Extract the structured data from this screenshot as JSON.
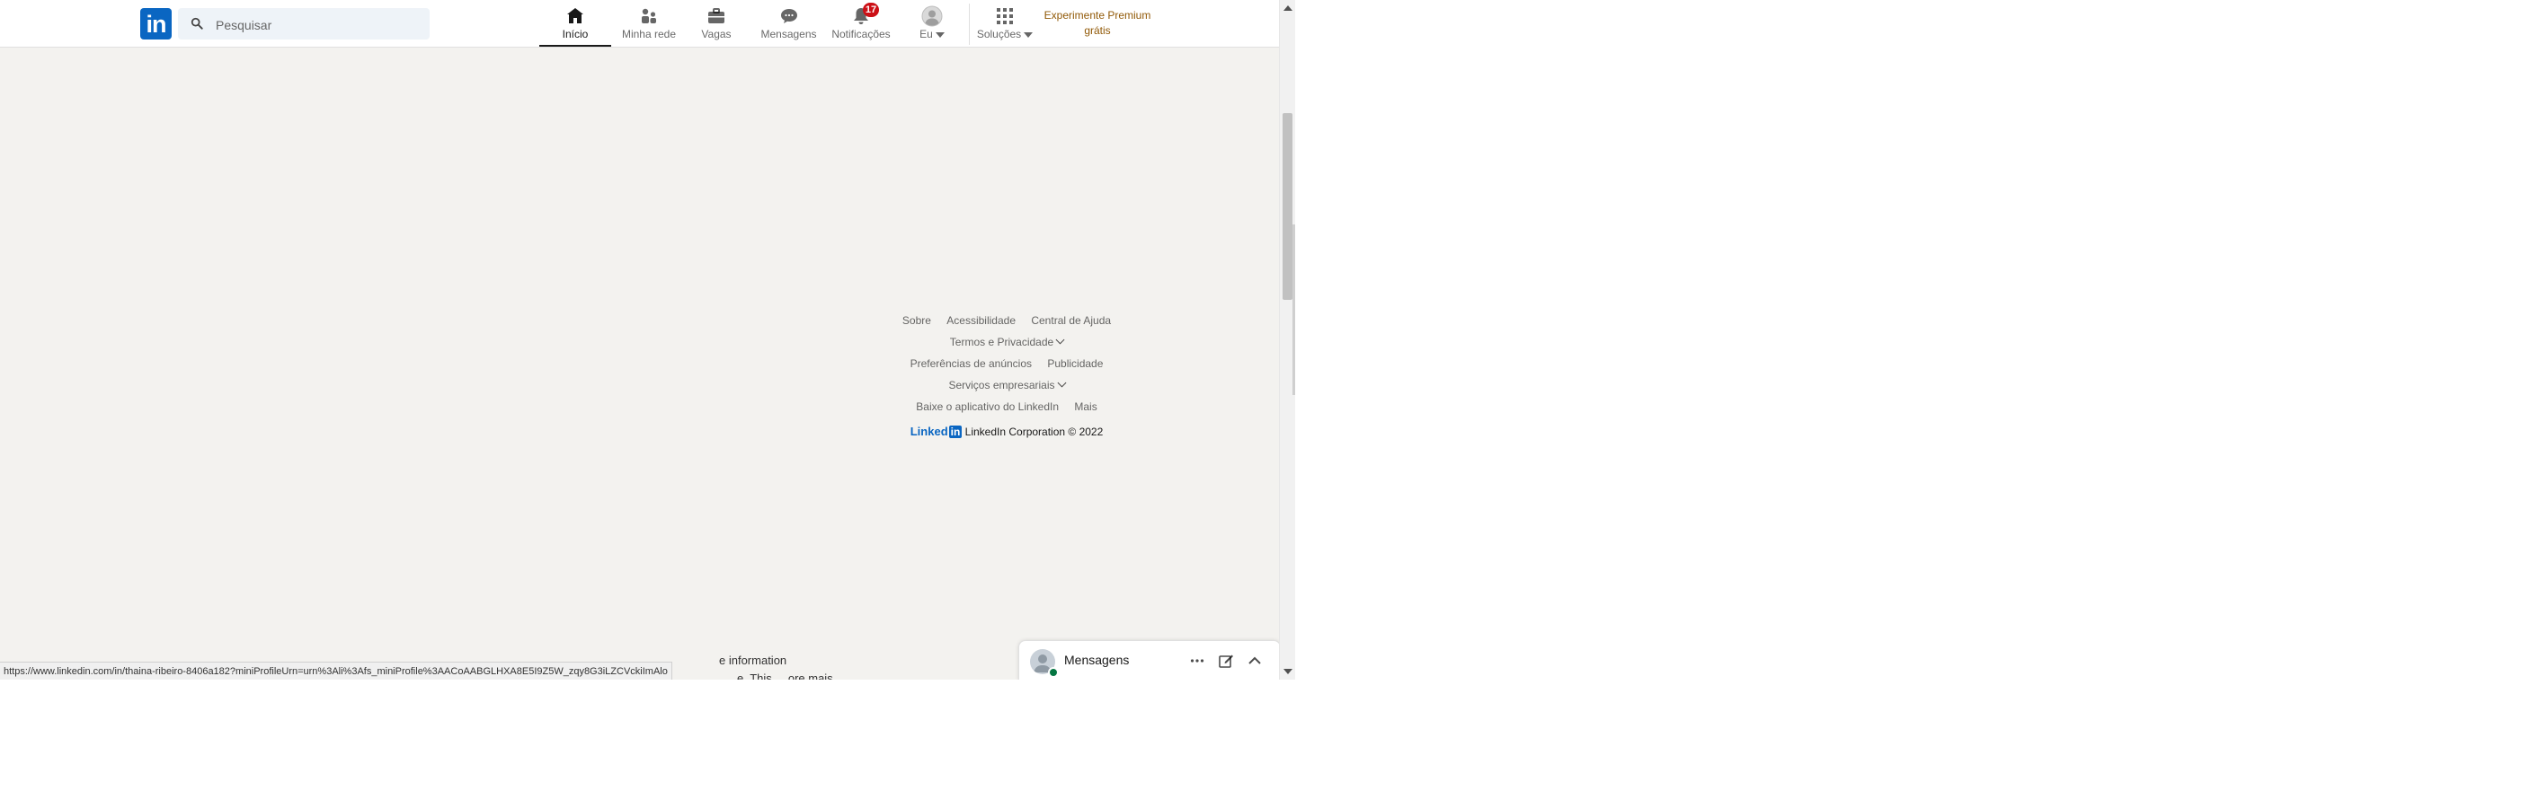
{
  "nav": {
    "search": {
      "placeholder": "Pesquisar"
    },
    "items": [
      {
        "label": "Início",
        "icon": "home-icon",
        "active": true
      },
      {
        "label": "Minha rede",
        "icon": "my-network-icon"
      },
      {
        "label": "Vagas",
        "icon": "jobs-icon"
      },
      {
        "label": "Mensagens",
        "icon": "messaging-icon"
      },
      {
        "label": "Notificações",
        "icon": "bell-icon",
        "badge": "17"
      },
      {
        "label": "Eu",
        "icon": "avatar"
      },
      {
        "label": "Soluções",
        "icon": "grid-icon"
      }
    ],
    "premium_line1": "Experimente Premium",
    "premium_line2": "grátis"
  },
  "footer": {
    "links_row1": [
      "Sobre",
      "Acessibilidade",
      "Central de Ajuda"
    ],
    "terms": "Termos e Privacidade",
    "links_row3": [
      "Preferências de anúncios",
      "Publicidade"
    ],
    "business": "Serviços empresariais",
    "links_row5": [
      "Baixe o aplicativo do LinkedIn",
      "Mais"
    ],
    "logo_text": "Linked",
    "logo_in": "in",
    "copyright": "LinkedIn Corporation © 2022"
  },
  "messaging": {
    "title": "Mensagens"
  },
  "status_url": "https://www.linkedin.com/in/thaina-ribeiro-8406a182?miniProfileUrn=urn%3Ali%3Afs_miniProfile%3AACoAABGLHXA8E5I9Z5W_zqy8G3iLZCVckiImAlo",
  "partial_text_1": "e information",
  "partial_text_2": "e. This ... ore mais",
  "colors": {
    "brand": "#0a66c2",
    "badge": "#cc1016",
    "premium": "#915907",
    "background": "#f3f2ef"
  }
}
